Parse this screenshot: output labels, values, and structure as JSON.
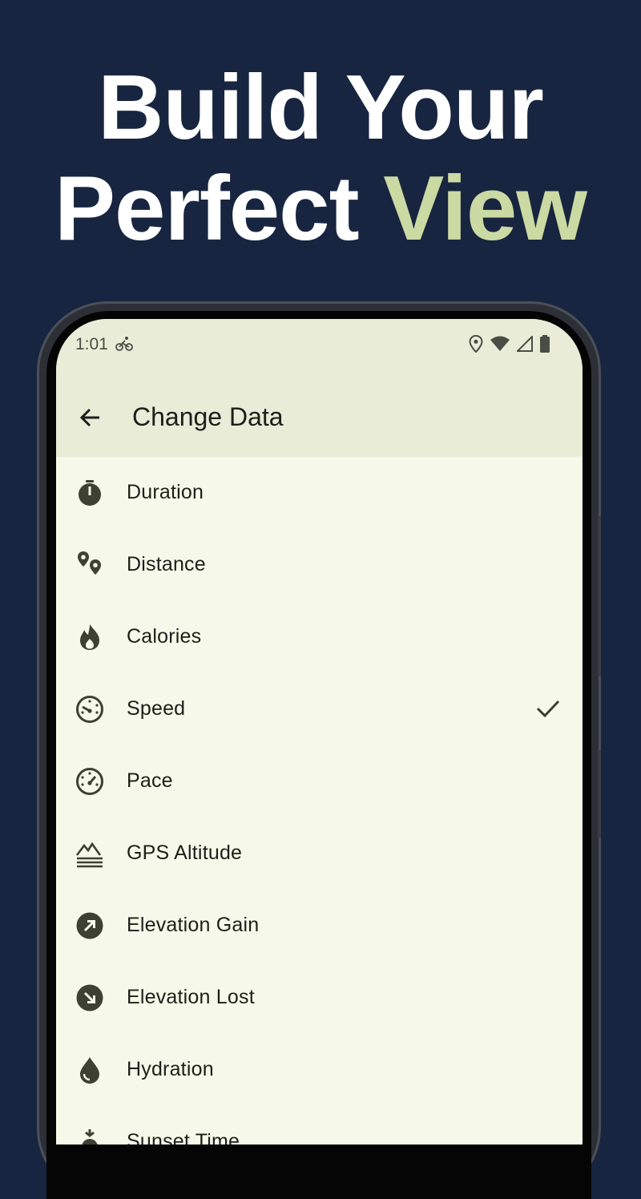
{
  "headline": {
    "line1": "Build Your",
    "line2_prefix": "Perfect ",
    "line2_accent": "View"
  },
  "colors": {
    "background": "#182540",
    "accent": "#cbd9a3",
    "screen": "#f6f8e9",
    "app_bar": "#e9ecd6",
    "icon": "#3d4032"
  },
  "status_bar": {
    "time": "1:01",
    "icons": [
      "cycling-icon",
      "location-icon",
      "wifi-icon",
      "signal-icon",
      "battery-icon"
    ]
  },
  "app_bar": {
    "back_icon": "arrow-back-icon",
    "title": "Change Data"
  },
  "items": [
    {
      "label": "Duration",
      "icon": "stopwatch-icon",
      "selected": false
    },
    {
      "label": "Distance",
      "icon": "route-pins-icon",
      "selected": false
    },
    {
      "label": "Calories",
      "icon": "flame-icon",
      "selected": false
    },
    {
      "label": "Speed",
      "icon": "speedometer-icon",
      "selected": true
    },
    {
      "label": "Pace",
      "icon": "gauge-icon",
      "selected": false
    },
    {
      "label": "GPS Altitude",
      "icon": "altitude-icon",
      "selected": false
    },
    {
      "label": "Elevation Gain",
      "icon": "arrow-up-right-circle-icon",
      "selected": false
    },
    {
      "label": "Elevation Lost",
      "icon": "arrow-down-right-circle-icon",
      "selected": false
    },
    {
      "label": "Hydration",
      "icon": "water-drop-icon",
      "selected": false
    },
    {
      "label": "Sunset Time",
      "icon": "sunset-icon",
      "selected": false
    }
  ]
}
